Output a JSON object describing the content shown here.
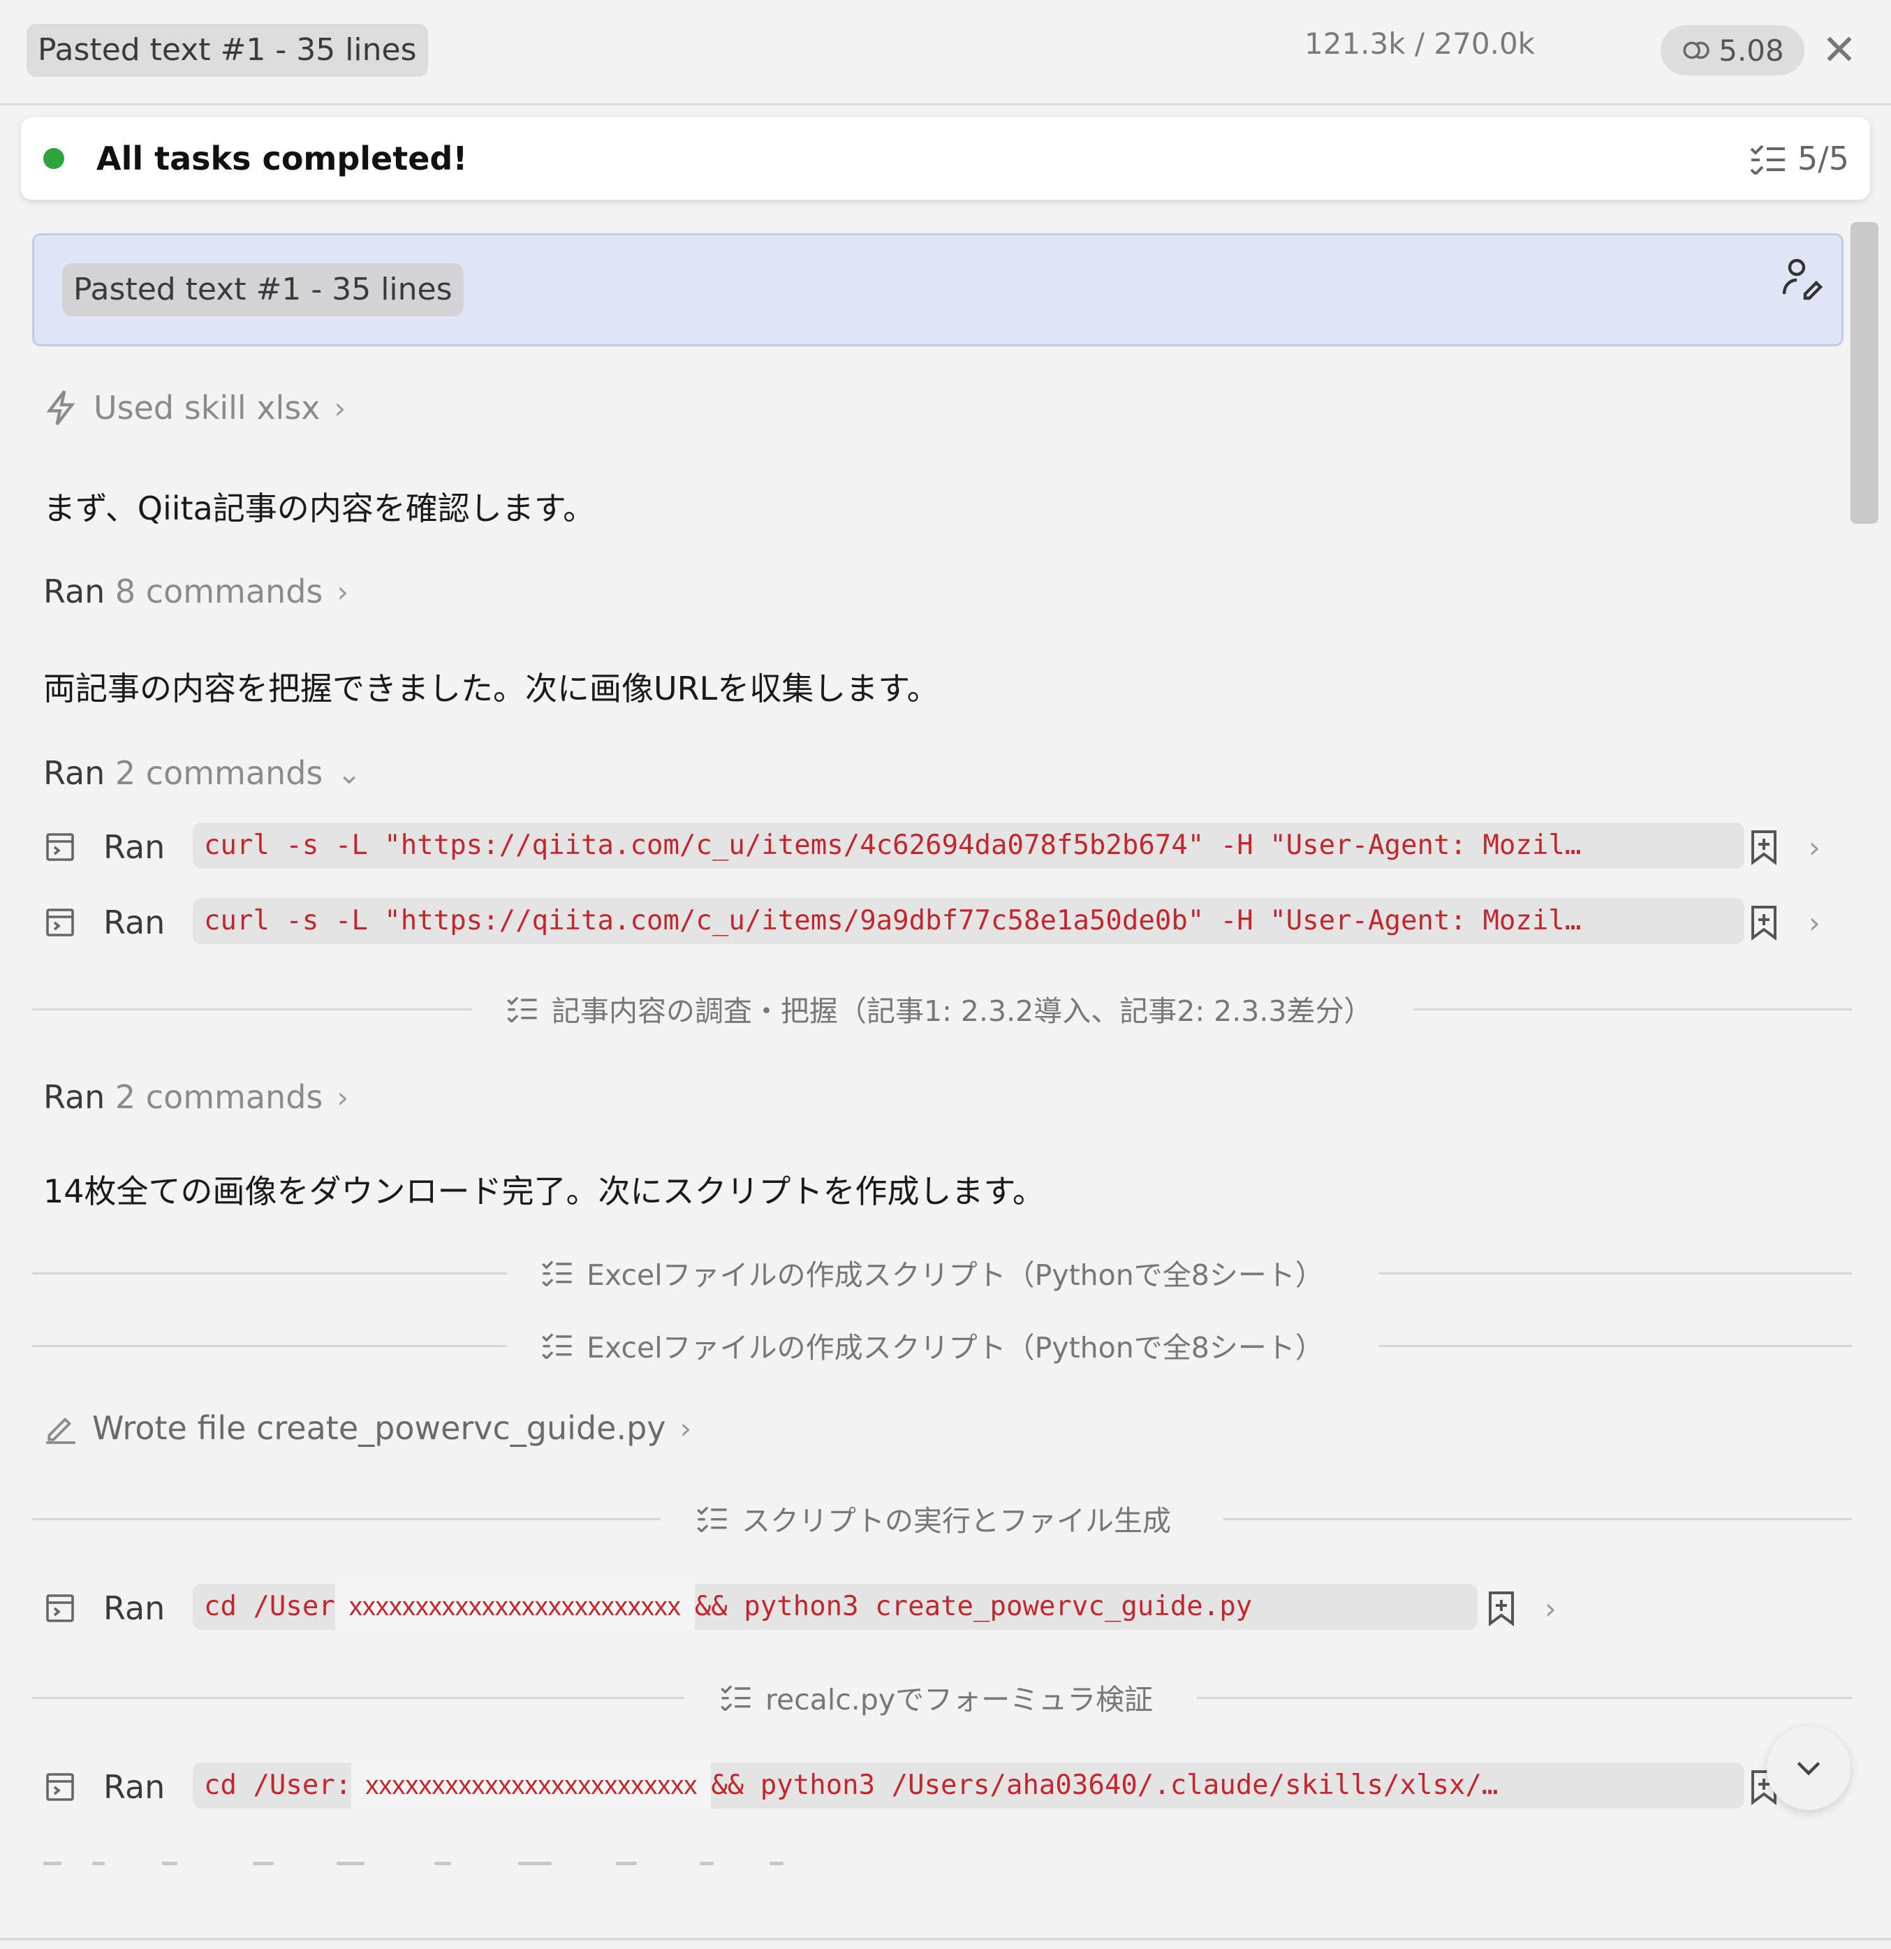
{
  "header": {
    "pasted_chip": "Pasted text #1 - 35 lines",
    "tokens": "121.3k / 270.0k",
    "cost": "5.08"
  },
  "status": {
    "label": "All tasks completed!",
    "count": "5/5",
    "dot_color": "#2fa33b"
  },
  "prompt": {
    "chip": "Pasted text #1 - 35 lines"
  },
  "skill": {
    "label": "Used skill xlsx"
  },
  "messages": {
    "m1": "まず、Qiita記事の内容を確認します。",
    "m2": "両記事の内容を把握できました。次に画像URLを収集します。",
    "m3": "14枚全ての画像をダウンロード完了。次にスクリプトを作成します。"
  },
  "ran_groups": {
    "g1": {
      "ran": "Ran",
      "count": "8 commands"
    },
    "g2": {
      "ran": "Ran",
      "count": "2 commands"
    },
    "g3": {
      "ran": "Ran",
      "count": "2 commands"
    }
  },
  "commands": {
    "ran_label": "Ran",
    "c1": "curl -s -L \"https://qiita.com/c_u/items/4c62694da078f5b2b674\" -H \"User-Agent: Mozil…",
    "c2": "curl -s -L \"https://qiita.com/c_u/items/9a9dbf77c58e1a50de0b\" -H \"User-Agent: Mozil…",
    "c3_pre": "cd /User",
    "c3_redact": "xxxxxxxxxxxxxxxxxxxxxxxxx",
    "c3_post": "&& python3 create_powervc_guide.py",
    "c4_pre": "cd /User:",
    "c4_redact": "xxxxxxxxxxxxxxxxxxxxxxxxx",
    "c4_post": "&& python3 /Users/aha03640/.claude/skills/xlsx/…"
  },
  "dividers": {
    "d1": "記事内容の調査・把握（記事1: 2.3.2導入、記事2: 2.3.3差分）",
    "d2": "Excelファイルの作成スクリプト（Pythonで全8シート）",
    "d3": "Excelファイルの作成スクリプト（Pythonで全8シート）",
    "d4": "スクリプトの実行とファイル生成",
    "d5": "recalc.pyでフォーミュラ検証"
  },
  "file": {
    "label": "Wrote file create_powervc_guide.py"
  },
  "colors": {
    "accent_red": "#c2272d",
    "prompt_bg": "#dfe5f5"
  }
}
